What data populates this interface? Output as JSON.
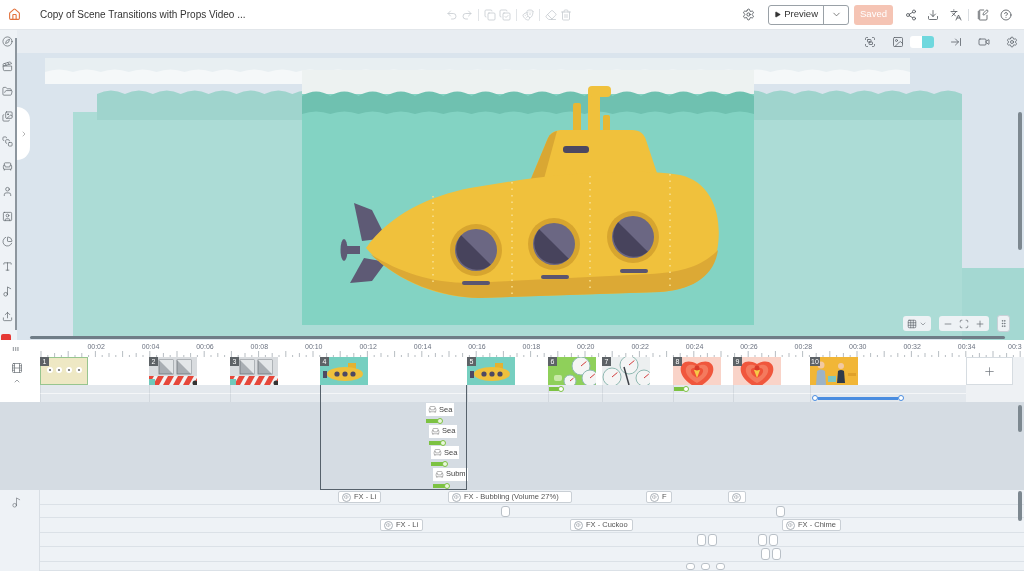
{
  "header": {
    "title": "Copy of Scene Transitions with Props Video ...",
    "edit_tools": [
      {
        "disabled": true
      },
      {
        "disabled": true
      },
      {
        "disabled": true
      },
      {
        "disabled": true
      },
      {
        "disabled": true
      },
      {
        "disabled": true
      },
      {
        "disabled": true
      }
    ],
    "preview": {
      "label": "Preview"
    },
    "save": {
      "label": "Saved",
      "disabled": true
    }
  },
  "canvas_toolbar": {
    "swatches": [
      {
        "color": "#ffffff"
      },
      {
        "color": "#6fd8de"
      }
    ]
  },
  "timeline": {
    "ruler": [
      "00:02",
      "00:04",
      "00:06",
      "00:08",
      "00:10",
      "00:12",
      "00:14",
      "00:16",
      "00:18",
      "00:20",
      "00:22",
      "00:24",
      "00:26",
      "00:28",
      "00:30",
      "00:32",
      "00:34",
      "00:3"
    ],
    "scenes": [
      {
        "number": "1",
        "kind": "dots",
        "selected": false,
        "transition": false,
        "lower_bar": false
      },
      {
        "number": "2",
        "kind": "bus",
        "selected": false,
        "transition": false,
        "lower_bar": false
      },
      {
        "number": "3",
        "kind": "bus",
        "selected": false,
        "transition": false,
        "lower_bar": false
      },
      {
        "number": "4",
        "kind": "submarine",
        "selected": true,
        "transition": false,
        "lower_bar": false,
        "props": [
          {
            "label": "Sea"
          },
          {
            "label": "Sea"
          },
          {
            "label": "Sea"
          },
          {
            "label": "Subm"
          }
        ]
      },
      {
        "number": "5",
        "kind": "submarine",
        "selected": false,
        "transition": false,
        "lower_bar": false
      },
      {
        "number": "6",
        "kind": "field",
        "selected": false,
        "transition": true,
        "lower_bar": false
      },
      {
        "number": "7",
        "kind": "gauges",
        "selected": false,
        "transition": false,
        "lower_bar": false
      },
      {
        "number": "8",
        "kind": "heart",
        "selected": false,
        "transition": true,
        "lower_bar": false
      },
      {
        "number": "9",
        "kind": "heart",
        "selected": false,
        "transition": false,
        "lower_bar": false
      },
      {
        "number": "10",
        "kind": "office",
        "selected": false,
        "transition": false,
        "lower_bar": true
      }
    ]
  },
  "audio": {
    "rows": [
      {
        "clips": [
          {
            "kind": "labeled",
            "label": "FX - Li"
          },
          {
            "kind": "labeled",
            "label": "FX - Bubbling (Volume 27%)"
          },
          {
            "kind": "labeled",
            "label": "F"
          },
          {
            "kind": "icon"
          }
        ]
      },
      {
        "clips": [
          {
            "kind": "mini"
          },
          {
            "kind": "mini"
          }
        ]
      },
      {
        "clips": [
          {
            "kind": "labeled",
            "label": "FX - Li"
          },
          {
            "kind": "labeled",
            "label": "FX - Cuckoo"
          },
          {
            "kind": "labeled",
            "label": "FX - Chime"
          }
        ]
      },
      {
        "clips": [
          {
            "kind": "mini"
          },
          {
            "kind": "mini"
          },
          {
            "kind": "mini"
          },
          {
            "kind": "mini"
          }
        ]
      },
      {
        "clips": [
          {
            "kind": "mini"
          },
          {
            "kind": "mini"
          }
        ]
      },
      {
        "clips": [
          {
            "kind": "mini"
          },
          {
            "kind": "mini"
          },
          {
            "kind": "mini"
          }
        ]
      }
    ]
  }
}
